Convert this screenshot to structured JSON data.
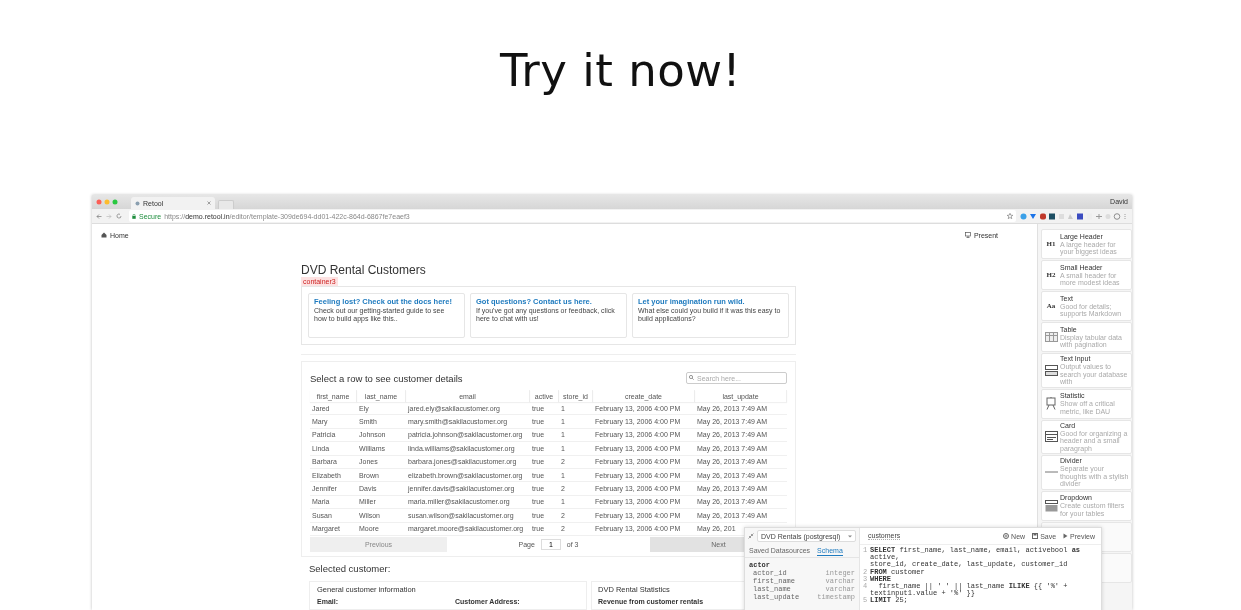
{
  "heading": "Try it now!",
  "browser": {
    "tab_title": "Retool",
    "user": "David",
    "secure_label": "Secure",
    "url": "https://**demo.retool.in**/editor/template-309de694-dd01-422c-864d-6867fe7eaef3"
  },
  "app": {
    "home": "Home",
    "present": "Present",
    "title": "DVD Rental Customers",
    "container_tag": "container3",
    "cards": [
      {
        "title": "Feeling lost? Check out the docs here!",
        "body": "Check out our getting-started guide to see how to build apps like this.."
      },
      {
        "title": "Got questions? Contact us here.",
        "body": "If you've got any questions or feedback, click here to chat with us!"
      },
      {
        "title": "Let your imagination run wild.",
        "body": "What else could you build if it was this easy to build applications?"
      }
    ],
    "table": {
      "title": "Select a row to see customer details",
      "search": {
        "placeholder": "Search here..."
      },
      "columns": [
        "first_name",
        "last_name",
        "email",
        "active",
        "store_id",
        "create_date",
        "last_update"
      ],
      "rows": [
        [
          "Jared",
          "Ely",
          "jared.ely@sakilacustomer.org",
          "true",
          "1",
          "February 13, 2006 4:00 PM",
          "May 26, 2013 7:49 AM"
        ],
        [
          "Mary",
          "Smith",
          "mary.smith@sakilacustomer.org",
          "true",
          "1",
          "February 13, 2006 4:00 PM",
          "May 26, 2013 7:49 AM"
        ],
        [
          "Patricia",
          "Johnson",
          "patricia.johnson@sakilacustomer.org",
          "true",
          "1",
          "February 13, 2006 4:00 PM",
          "May 26, 2013 7:49 AM"
        ],
        [
          "Linda",
          "Williams",
          "linda.williams@sakilacustomer.org",
          "true",
          "1",
          "February 13, 2006 4:00 PM",
          "May 26, 2013 7:49 AM"
        ],
        [
          "Barbara",
          "Jones",
          "barbara.jones@sakilacustomer.org",
          "true",
          "2",
          "February 13, 2006 4:00 PM",
          "May 26, 2013 7:49 AM"
        ],
        [
          "Elizabeth",
          "Brown",
          "elizabeth.brown@sakilacustomer.org",
          "true",
          "1",
          "February 13, 2006 4:00 PM",
          "May 26, 2013 7:49 AM"
        ],
        [
          "Jennifer",
          "Davis",
          "jennifer.davis@sakilacustomer.org",
          "true",
          "2",
          "February 13, 2006 4:00 PM",
          "May 26, 2013 7:49 AM"
        ],
        [
          "Maria",
          "Miller",
          "maria.miller@sakilacustomer.org",
          "true",
          "1",
          "February 13, 2006 4:00 PM",
          "May 26, 2013 7:49 AM"
        ],
        [
          "Susan",
          "Wilson",
          "susan.wilson@sakilacustomer.org",
          "true",
          "2",
          "February 13, 2006 4:00 PM",
          "May 26, 2013 7:49 AM"
        ],
        [
          "Margaret",
          "Moore",
          "margaret.moore@sakilacustomer.org",
          "true",
          "2",
          "February 13, 2006 4:00 PM",
          "May 26, 201"
        ]
      ],
      "pagination": {
        "previous": "Previous",
        "page_label": "Page",
        "page": "1",
        "of": "of 3",
        "next": "Next"
      }
    },
    "selected": {
      "title": "Selected customer:",
      "general": {
        "title": "General customer information",
        "labels": [
          "Email:",
          "Customer Address:"
        ]
      },
      "stats": {
        "title": "DVD Rental Statistics",
        "subtitle": "Revenue from customer rentals"
      }
    }
  },
  "sidebar": {
    "items": [
      {
        "kind": "glyph",
        "glyph": "H1",
        "title": "Large Header",
        "description": "A large header for your biggest ideas"
      },
      {
        "kind": "glyph",
        "glyph": "H2",
        "title": "Small Header",
        "description": "A small header for more modest ideas"
      },
      {
        "kind": "glyph",
        "glyph": "Aa",
        "title": "Text",
        "description": "Good for details; supports Markdown"
      },
      {
        "kind": "table",
        "title": "Table",
        "description": "Display tabular data with pagination"
      },
      {
        "kind": "input",
        "title": "Text Input",
        "description": "Output values to search your database with"
      },
      {
        "kind": "statistic",
        "title": "Statistic",
        "description": "Show off a critical metric, like DAU"
      },
      {
        "kind": "card",
        "title": "Card",
        "description": "Good for organizing a header and a small paragraph"
      },
      {
        "kind": "divider",
        "title": "Divider",
        "description": "Separate your thoughts with a stylish divider"
      },
      {
        "kind": "dropdown",
        "title": "Dropdown",
        "description": "Create custom filters for your tables"
      }
    ]
  },
  "query_editor": {
    "datasource": "DVD Rentals (postgresql)",
    "tabs": [
      {
        "label": "Saved Datasources",
        "selected": false
      },
      {
        "label": "Schema",
        "selected": true
      }
    ],
    "schema": {
      "table": "actor",
      "fields": [
        {
          "name": "actor_id",
          "type": "integer"
        },
        {
          "name": "first_name",
          "type": "varchar"
        },
        {
          "name": "last_name",
          "type": "varchar"
        },
        {
          "name": "last_update",
          "type": "timestamp"
        }
      ]
    },
    "query_name": "customers",
    "actions": [
      {
        "kind": "new",
        "label": "New"
      },
      {
        "kind": "save",
        "label": "Save"
      },
      {
        "kind": "preview",
        "label": "Preview"
      }
    ],
    "lines": [
      {
        "number": "1",
        "text": "**SELECT** first_name, last_name, email, activebool **as** active,"
      },
      {
        "text": "store_id, create_date, last_update, customer_id"
      },
      {
        "number": "2",
        "text": "**FROM** customer"
      },
      {
        "number": "3",
        "text": "**WHERE**"
      },
      {
        "number": "4",
        "text": "  first_name || ' ' || last_name **ILIKE** {{ '%' +"
      },
      {
        "text": "textinput1.value + '%' }}"
      },
      {
        "number": "5",
        "text": "**LIMIT** 25;"
      }
    ]
  }
}
